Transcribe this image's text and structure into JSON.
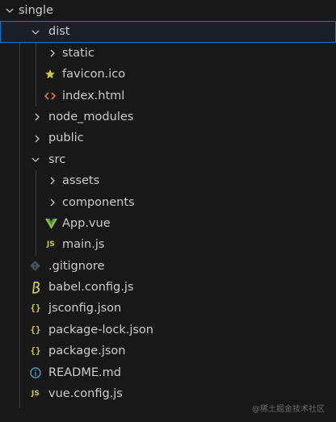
{
  "explorer": {
    "items": [
      {
        "label": "single",
        "kind": "folder-open",
        "depth": 0
      },
      {
        "label": "dist",
        "kind": "folder-open",
        "depth": 1,
        "selected": true
      },
      {
        "label": "static",
        "kind": "folder-closed",
        "depth": 2
      },
      {
        "label": "favicon.ico",
        "kind": "file",
        "icon": "star-icon",
        "depth": 2
      },
      {
        "label": "index.html",
        "kind": "file",
        "icon": "html-icon",
        "depth": 2
      },
      {
        "label": "node_modules",
        "kind": "folder-closed",
        "depth": 1
      },
      {
        "label": "public",
        "kind": "folder-closed",
        "depth": 1
      },
      {
        "label": "src",
        "kind": "folder-open",
        "depth": 1
      },
      {
        "label": "assets",
        "kind": "folder-closed",
        "depth": 2
      },
      {
        "label": "components",
        "kind": "folder-closed",
        "depth": 2
      },
      {
        "label": "App.vue",
        "kind": "file",
        "icon": "vue-icon",
        "depth": 2
      },
      {
        "label": "main.js",
        "kind": "file",
        "icon": "js-icon",
        "depth": 2
      },
      {
        "label": ".gitignore",
        "kind": "file",
        "icon": "git-icon",
        "depth": 1
      },
      {
        "label": "babel.config.js",
        "kind": "file",
        "icon": "babel-icon",
        "depth": 1
      },
      {
        "label": "jsconfig.json",
        "kind": "file",
        "icon": "json-icon",
        "depth": 1
      },
      {
        "label": "package-lock.json",
        "kind": "file",
        "icon": "json-icon",
        "depth": 1
      },
      {
        "label": "package.json",
        "kind": "file",
        "icon": "json-icon",
        "depth": 1
      },
      {
        "label": "README.md",
        "kind": "file",
        "icon": "info-icon",
        "depth": 1
      },
      {
        "label": "vue.config.js",
        "kind": "file",
        "icon": "js-icon",
        "depth": 1
      }
    ]
  },
  "icons": {
    "js_text": "JS",
    "json_text": "{}"
  },
  "colors": {
    "background": "#181818",
    "text": "#cccccc",
    "selection_border": "#0078d4",
    "star": "#cbcb41",
    "html": "#e37933",
    "vue": "#8dc149",
    "js": "#cbcb41",
    "info": "#519aba",
    "git": "#41535b"
  },
  "watermark": "@稀土掘金技术社区"
}
